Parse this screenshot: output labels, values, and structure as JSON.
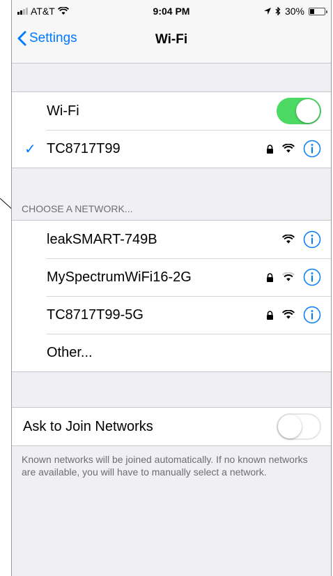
{
  "status_bar": {
    "carrier": "AT&T",
    "time": "9:04 PM",
    "battery": "30%"
  },
  "nav": {
    "back_label": "Settings",
    "title": "Wi-Fi"
  },
  "wifi_toggle": {
    "label": "Wi-Fi",
    "enabled": true
  },
  "connected_network": {
    "name": "TC8717T99",
    "secured": true
  },
  "networks_section": {
    "header": "CHOOSE A NETWORK...",
    "items": [
      {
        "name": "leakSMART-749B",
        "secured": false
      },
      {
        "name": "MySpectrumWiFi16-2G",
        "secured": true
      },
      {
        "name": "TC8717T99-5G",
        "secured": true
      }
    ],
    "other_label": "Other..."
  },
  "ask_to_join": {
    "label": "Ask to Join Networks",
    "enabled": false
  },
  "footer_text": "Known networks will be joined automatically. If no known networks are available, you will have to manually select a network.",
  "colors": {
    "accent": "#007aff",
    "toggle_on": "#4cd964",
    "background": "#efeff4"
  }
}
